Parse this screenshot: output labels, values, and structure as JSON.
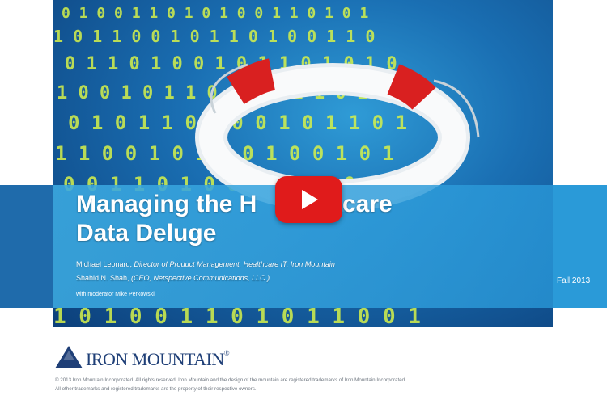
{
  "slide": {
    "title_line1": "Managing the H",
    "title_line1_hidden": "ealthcare",
    "title_line1_end": "care",
    "title_line2": "Data Deluge",
    "presenter1_name": "Michael Leonard, ",
    "presenter1_role": "Director of Product Management, Healthcare IT, Iron Mountain",
    "presenter2_name": "Shahid N. Shah, ",
    "presenter2_role": "(CEO, Netspective Communications, LLC.)",
    "moderator": "with moderator Mike Perkowski",
    "date": "Fall 2013"
  },
  "logo": {
    "name": "IRON MOUNTAIN",
    "registered": "®"
  },
  "legal": {
    "line1": "© 2013 Iron Mountain Incorporated. All rights reserved. Iron Mountain and the design of the mountain are registered trademarks of Iron Mountain Incorporated.",
    "line2": "All other trademarks and registered trademarks are the property of their respective owners."
  },
  "video": {
    "play_icon": "play-icon"
  },
  "colors": {
    "play_red": "#e01b1b",
    "band_blue": "#2a9ad8",
    "logo_navy": "#1f3f77",
    "digit_yellow": "#d6f24a"
  }
}
